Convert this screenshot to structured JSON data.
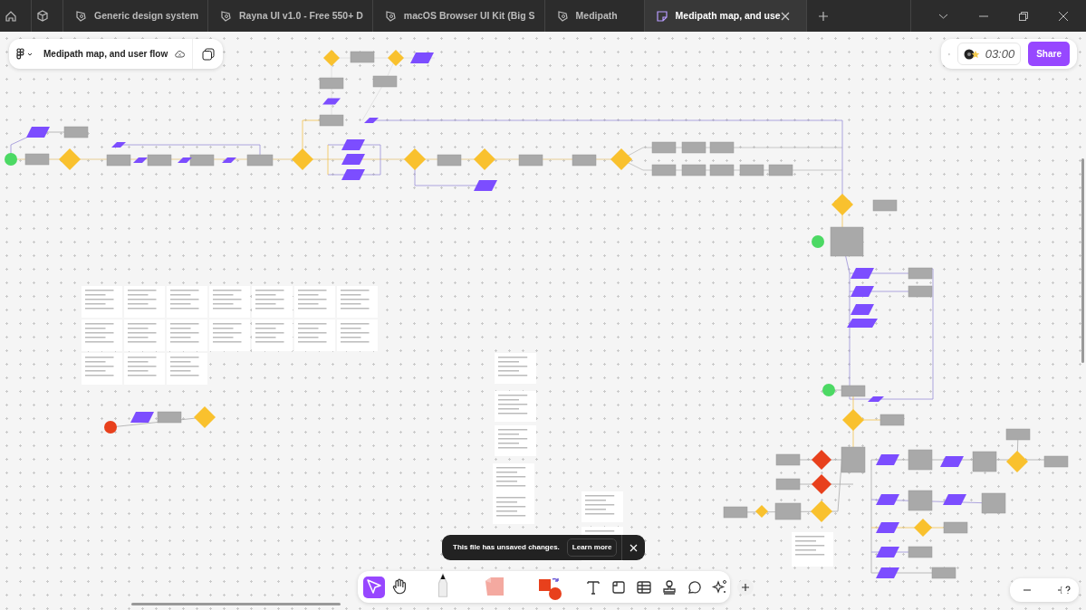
{
  "tab_bar": {
    "tabs": [
      {
        "kind": "home",
        "selected": false
      },
      {
        "kind": "community",
        "selected": false
      },
      {
        "kind": "design",
        "title": "Generic design system",
        "selected": false
      },
      {
        "kind": "design",
        "title": "Rayna UI v1.0 - Free 550+ D",
        "selected": false
      },
      {
        "kind": "design",
        "title": "macOS Browser UI Kit (Big S",
        "selected": false
      },
      {
        "kind": "design",
        "title": "Medipath",
        "selected": false
      },
      {
        "kind": "figjam",
        "title": "Medipath map, and use",
        "selected": true
      }
    ]
  },
  "file_header": {
    "title": "Medipath map, and user flow"
  },
  "top_right": {
    "timer": "03:00",
    "share": "Share"
  },
  "toast": {
    "message": "This file has unsaved changes.",
    "action": "Learn more"
  },
  "toolbar": {
    "tools": [
      {
        "kind": "select",
        "selected": true
      },
      {
        "kind": "hand",
        "selected": false
      },
      {
        "kind": "marker",
        "selected": false
      },
      {
        "kind": "sticky",
        "selected": false
      },
      {
        "kind": "shapes",
        "selected": false
      },
      {
        "kind": "text",
        "selected": false
      },
      {
        "kind": "section",
        "selected": false
      },
      {
        "kind": "table",
        "selected": false
      },
      {
        "kind": "stamp",
        "selected": false
      },
      {
        "kind": "comment",
        "selected": false
      },
      {
        "kind": "ai",
        "selected": false
      },
      {
        "kind": "more",
        "selected": false
      }
    ]
  }
}
